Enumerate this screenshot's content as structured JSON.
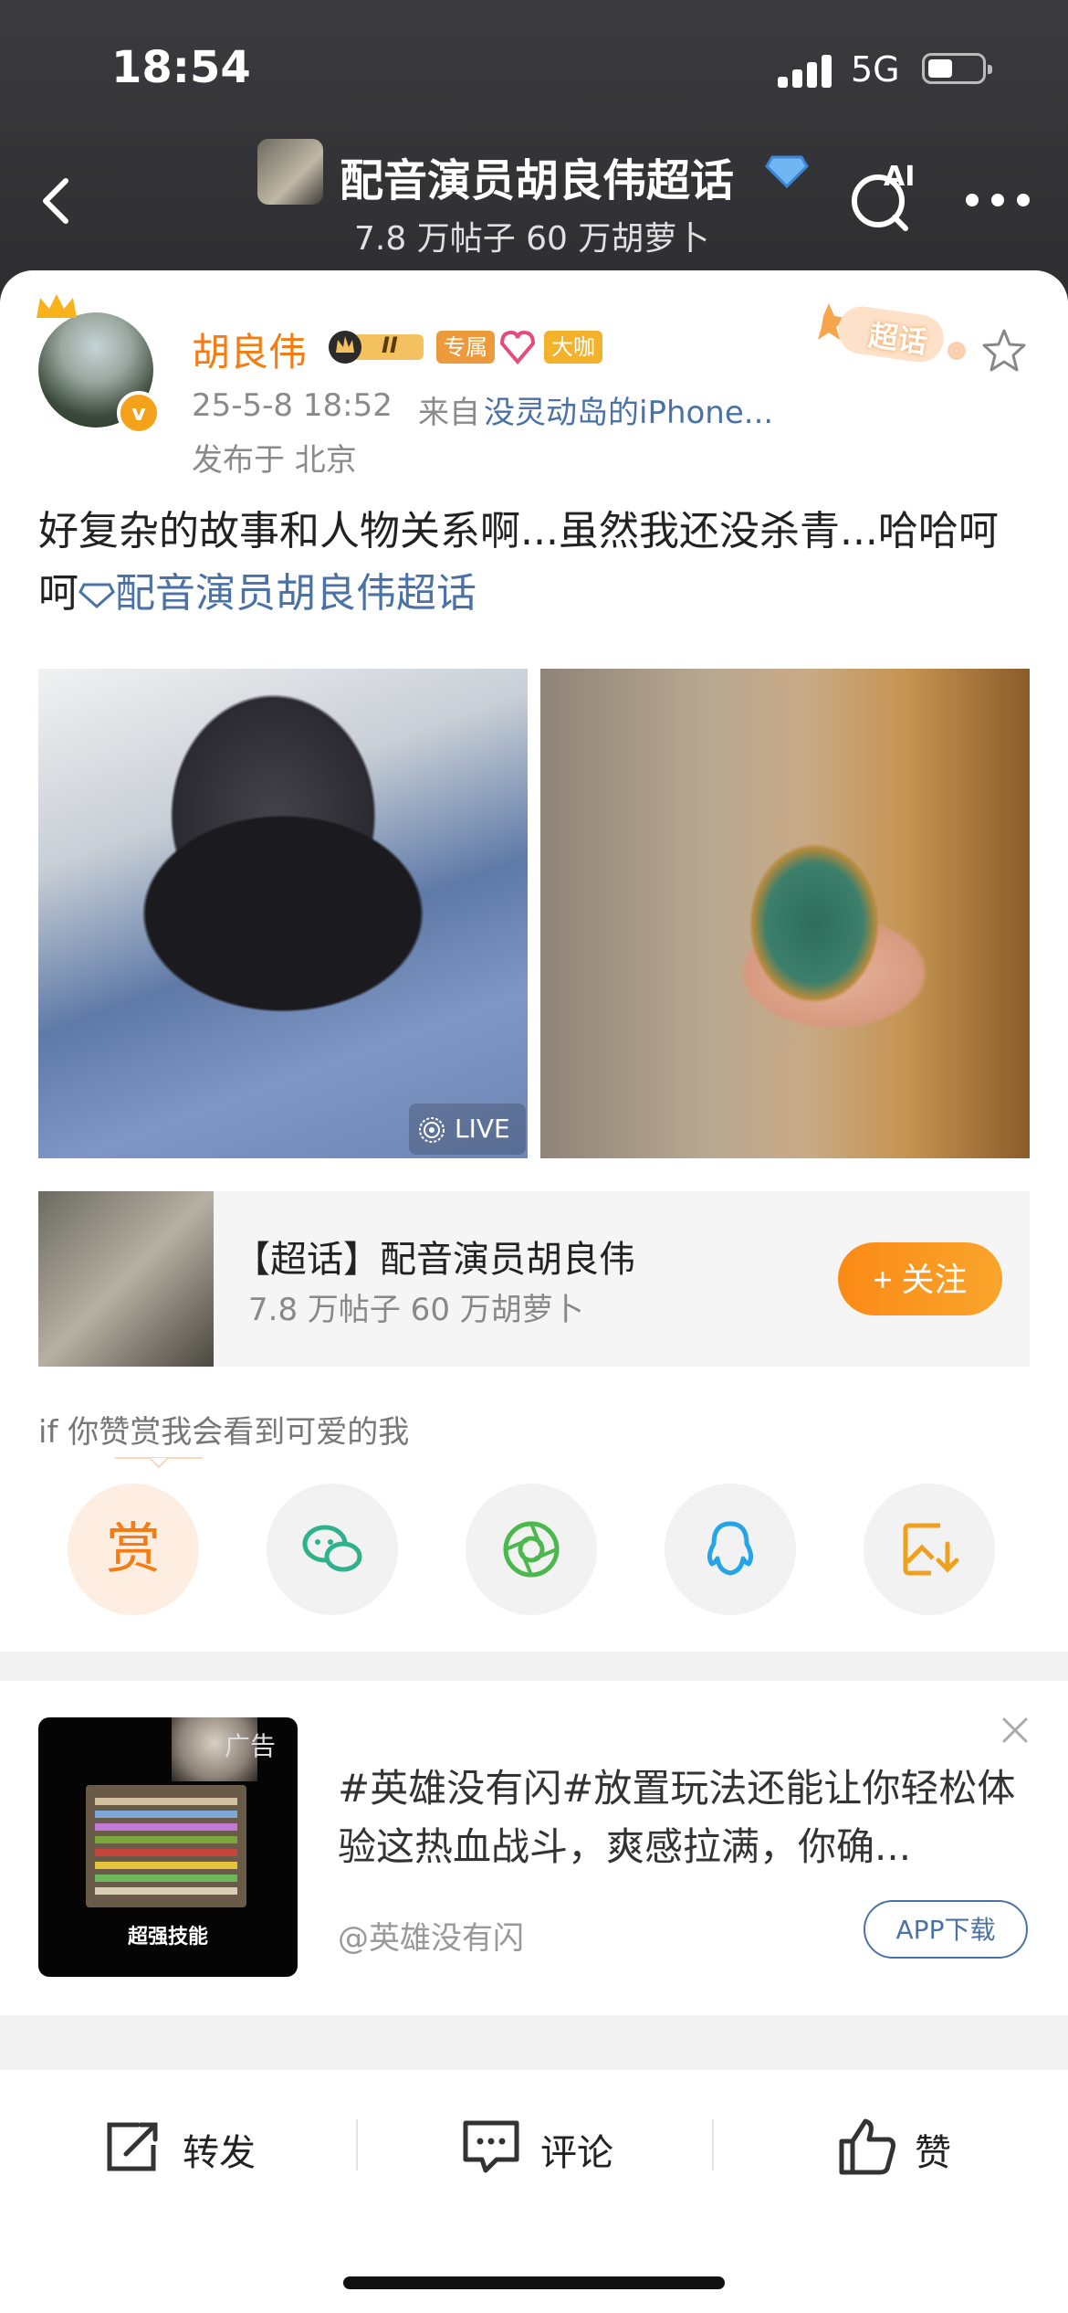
{
  "status_bar": {
    "time": "18:54",
    "network": "5G"
  },
  "header": {
    "title": "配音演员胡良伟超话",
    "subtitle": "7.8 万帖子  60 万胡萝卜",
    "ai_label": "AI"
  },
  "post": {
    "author": "胡良伟",
    "level_badge": "II",
    "tags": [
      "专属",
      "大咖"
    ],
    "time": "25-5-8 18:52",
    "from_prefix": "来自",
    "device": "没灵动岛的iPhone...",
    "location": "发布于 北京",
    "sticker": "超话",
    "text": "好复杂的故事和人物关系啊...虽然我还没杀青...哈哈呵呵",
    "topic_link": "配音演员胡良伟超话",
    "live_label": "LIVE"
  },
  "topic_card": {
    "title": "【超话】配音演员胡良伟",
    "subtitle": "7.8 万帖子  60 万胡萝卜",
    "follow_label": "+ 关注"
  },
  "reward": {
    "hint": "if 你赞赏我会看到可爱的我",
    "reward_char": "赏"
  },
  "share_icons": [
    "reward-icon",
    "wechat-icon",
    "moments-icon",
    "qq-icon",
    "save-image-icon"
  ],
  "ad": {
    "tag": "广告",
    "image_caption": "超强技能",
    "text": "#英雄没有闪#放置玩法还能让你轻松体验这热血战斗，爽感拉满，你确...",
    "source": "@英雄没有闪",
    "button": "APP下载"
  },
  "bottom_bar": {
    "repost": "转发",
    "comment": "评论",
    "like": "赞"
  },
  "colors": {
    "accent_orange": "#f47c12",
    "link_blue": "#4a72a6",
    "header_bg": "#2e2e31"
  }
}
